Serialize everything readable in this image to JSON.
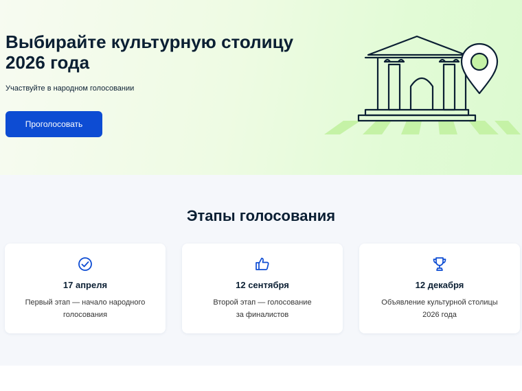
{
  "hero": {
    "title": "Выбирайте культурную столицу\n2026 года",
    "subtitle": "Участвуйте в народном голосовании",
    "button_label": "Проголосовать"
  },
  "stages": {
    "title": "Этапы голосования",
    "items": [
      {
        "date": "17 апреля",
        "description": "Первый этап — начало народного\nголосования",
        "icon": "check-circle-icon"
      },
      {
        "date": "12 сентября",
        "description": "Второй этап — голосование\nза финалистов",
        "icon": "thumbs-up-icon"
      },
      {
        "date": "12 декабря",
        "description": "Объявление культурной столицы\n2026 года",
        "icon": "trophy-icon"
      }
    ]
  },
  "colors": {
    "accent": "#0d4cd3",
    "text": "#0b1f33",
    "illustration_green": "#c5f2a6"
  }
}
